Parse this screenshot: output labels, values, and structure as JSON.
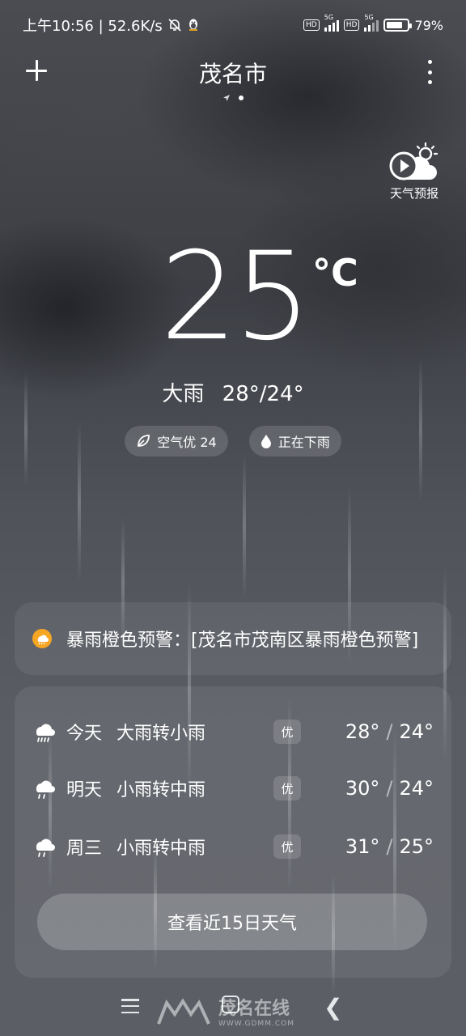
{
  "status": {
    "time_speed": "上午10:56 | 52.6K/s",
    "battery_pct": "79%",
    "net1": "5G",
    "net2": "5G",
    "hd": "HD"
  },
  "header": {
    "city": "茂名市"
  },
  "video_forecast": {
    "label": "天气预报"
  },
  "current": {
    "temperature": "25",
    "unit": "°C",
    "condition": "大雨",
    "range": "28°/24°"
  },
  "chips": {
    "air": "空气优 24",
    "rain": "正在下雨"
  },
  "warning": {
    "text": "暴雨橙色预警：[茂名市茂南区暴雨橙色预警]"
  },
  "daily": [
    {
      "day": "今天",
      "condition": "大雨转小雨",
      "aqi": "优",
      "high": "28°",
      "low": "24°",
      "icon": "heavy-rain-icon"
    },
    {
      "day": "明天",
      "condition": "小雨转中雨",
      "aqi": "优",
      "high": "30°",
      "low": "24°",
      "icon": "light-rain-icon"
    },
    {
      "day": "周三",
      "condition": "小雨转中雨",
      "aqi": "优",
      "high": "31°",
      "low": "25°",
      "icon": "light-rain-icon"
    }
  ],
  "daily_separator": "/",
  "button_15": "查看近15日天气",
  "watermark": {
    "text": "茂名在线",
    "url": "WWW.GDMM.COM"
  },
  "colors": {
    "warning_orange": "#f5a623",
    "background": "#4a4c52"
  }
}
